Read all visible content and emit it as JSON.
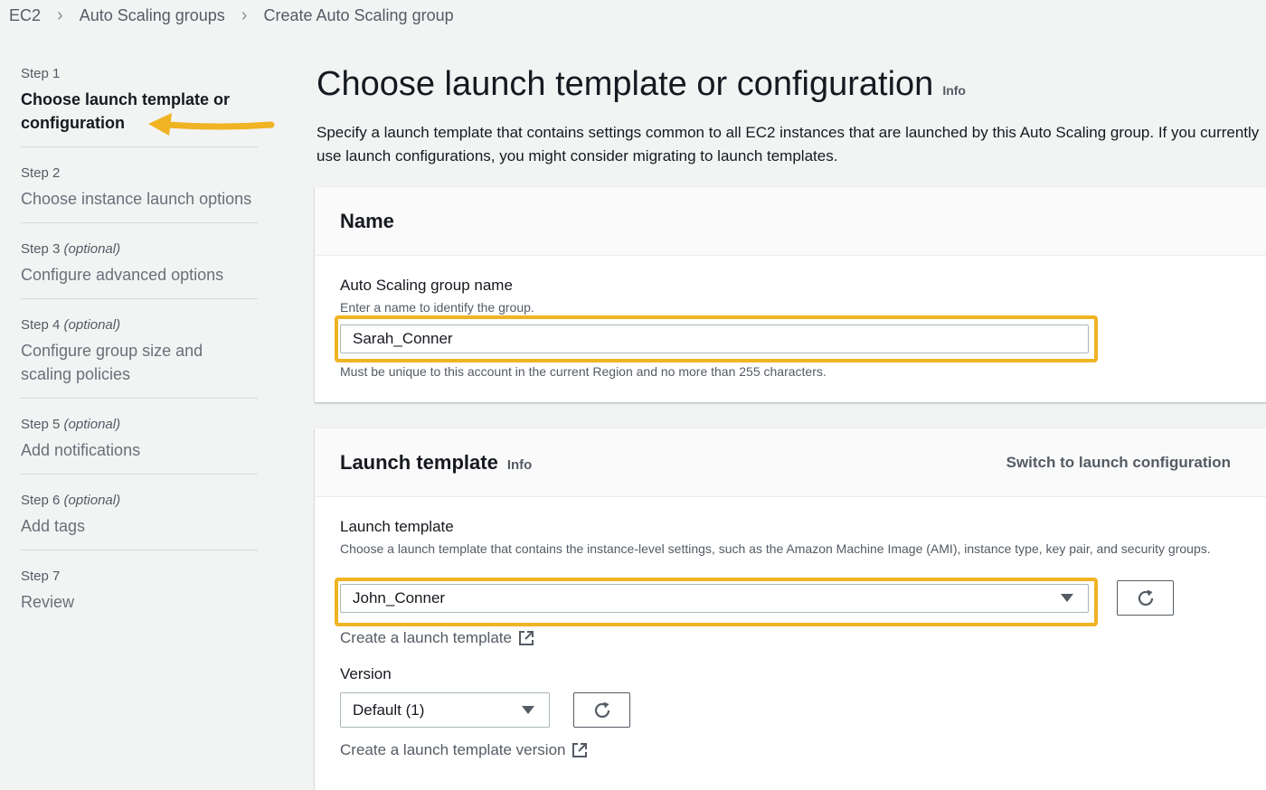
{
  "breadcrumb": [
    "EC2",
    "Auto Scaling groups",
    "Create Auto Scaling group"
  ],
  "steps": [
    {
      "num": "Step 1",
      "optional": "",
      "title": "Choose launch template or configuration",
      "active": true
    },
    {
      "num": "Step 2",
      "optional": "",
      "title": "Choose instance launch options",
      "active": false
    },
    {
      "num": "Step 3",
      "optional": "(optional)",
      "title": "Configure advanced options",
      "active": false
    },
    {
      "num": "Step 4",
      "optional": "(optional)",
      "title": "Configure group size and scaling policies",
      "active": false
    },
    {
      "num": "Step 5",
      "optional": "(optional)",
      "title": "Add notifications",
      "active": false
    },
    {
      "num": "Step 6",
      "optional": "(optional)",
      "title": "Add tags",
      "active": false
    },
    {
      "num": "Step 7",
      "optional": "",
      "title": "Review",
      "active": false
    }
  ],
  "page": {
    "title": "Choose launch template or configuration",
    "info": "Info",
    "description": "Specify a launch template that contains settings common to all EC2 instances that are launched by this Auto Scaling group. If you currently use launch configurations, you might consider migrating to launch templates."
  },
  "name_panel": {
    "title": "Name",
    "label": "Auto Scaling group name",
    "hint": "Enter a name to identify the group.",
    "value": "Sarah_Conner",
    "note": "Must be unique to this account in the current Region and no more than 255 characters."
  },
  "template_panel": {
    "title": "Launch template",
    "info": "Info",
    "switch_link": "Switch to launch configuration",
    "label": "Launch template",
    "hint": "Choose a launch template that contains the instance-level settings, such as the Amazon Machine Image (AMI), instance type, key pair, and security groups.",
    "selected": "John_Conner",
    "create_link": "Create a launch template",
    "version_label": "Version",
    "version_selected": "Default (1)",
    "create_version_link": "Create a launch template version"
  },
  "colors": {
    "highlight": "#f0b323",
    "background": "#f2f3f3",
    "panel_header": "#fafafa"
  }
}
